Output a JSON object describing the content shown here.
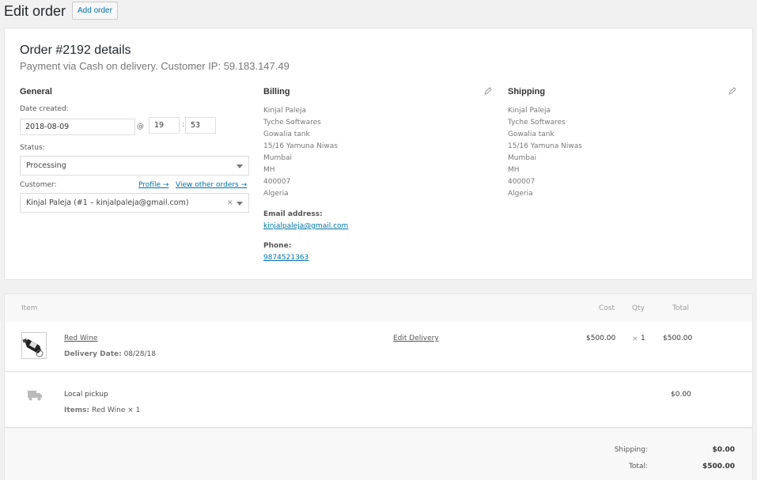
{
  "header": {
    "title": "Edit order",
    "add_button": "Add order"
  },
  "order": {
    "title": "Order #2192 details",
    "subtitle": "Payment via Cash on delivery. Customer IP: 59.183.147.49"
  },
  "general": {
    "heading": "General",
    "date_label": "Date created:",
    "date": "2018-08-09",
    "at": "@",
    "hour": "19",
    "colon": ":",
    "minute": "53",
    "status_label": "Status:",
    "status": "Processing",
    "customer_label": "Customer:",
    "profile_link": "Profile →",
    "other_orders_link": "View other orders →",
    "customer": "Kinjal Paleja (#1 – kinjalpaleja@gmail.com)",
    "clear": "×"
  },
  "billing": {
    "heading": "Billing",
    "lines": [
      "Kinjal Paleja",
      "Tyche Softwares",
      "Gowalia tank",
      "15/16 Yamuna Niwas",
      "Mumbai",
      "MH",
      "400007",
      "Algeria"
    ],
    "email_label": "Email address:",
    "email": "kinjalpaleja@gmail.com",
    "phone_label": "Phone:",
    "phone": "9874521363"
  },
  "shipping": {
    "heading": "Shipping",
    "lines": [
      "Kinjal Paleja",
      "Tyche Softwares",
      "Gowalia tank",
      "15/16 Yamuna Niwas",
      "Mumbai",
      "MH",
      "400007",
      "Algeria"
    ]
  },
  "items_table": {
    "headers": {
      "item": "Item",
      "cost": "Cost",
      "qty": "Qty",
      "total": "Total"
    },
    "item": {
      "name": "Red Wine",
      "meta_label": "Delivery Date:",
      "meta_value": "08/28/18",
      "edit_link": "Edit Delivery",
      "cost": "$500.00",
      "qty_x": "×",
      "qty": "1",
      "total": "$500.00"
    },
    "shipping_line": {
      "name": "Local pickup",
      "meta_label": "Items:",
      "meta_value": "Red Wine × 1",
      "total": "$0.00"
    }
  },
  "totals": {
    "shipping_label": "Shipping:",
    "shipping": "$0.00",
    "total_label": "Total:",
    "total": "$500.00"
  },
  "icons": {
    "edit": "pencil-icon",
    "shipping": "truck-icon",
    "product": "wine-bottle-thumbnail"
  }
}
